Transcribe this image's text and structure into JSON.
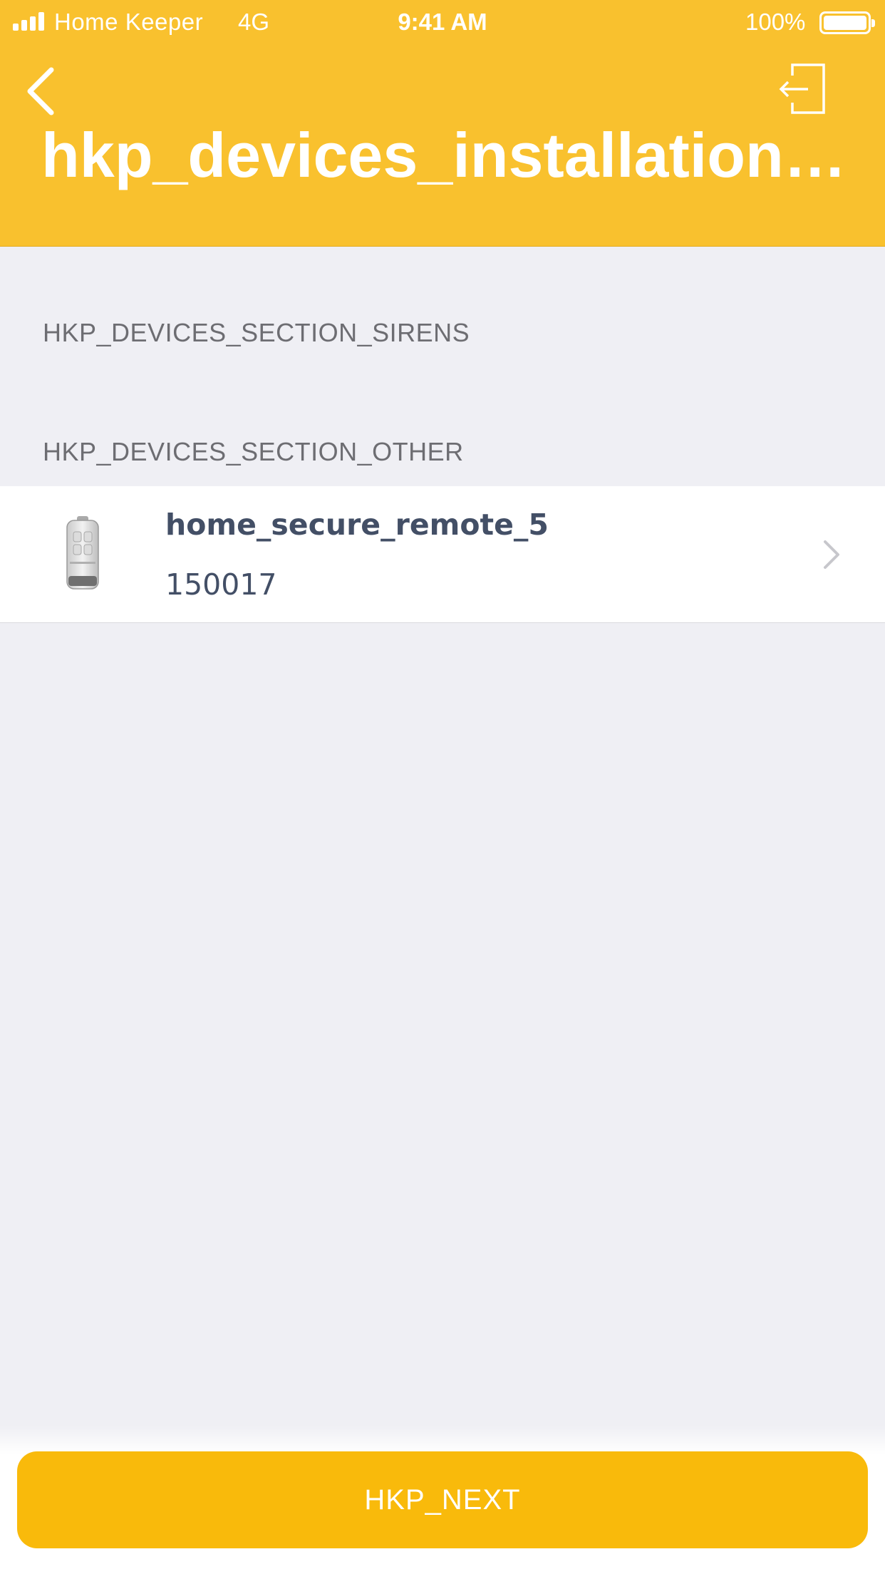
{
  "status_bar": {
    "carrier": "Home Keeper",
    "network": "4G",
    "time": "9:41 AM",
    "battery_percent": "100%"
  },
  "nav": {
    "back_icon": "chevron-left-icon",
    "exit_icon": "logout-icon",
    "title": "hkp_devices_installation_..."
  },
  "sections": [
    {
      "header": "HKP_DEVICES_SECTION_SIRENS",
      "items": []
    },
    {
      "header": "HKP_DEVICES_SECTION_OTHER",
      "items": [
        {
          "name": "home_secure_remote_5",
          "id": "150017",
          "icon": "remote-control-icon"
        }
      ]
    }
  ],
  "footer": {
    "next_label": "HKP_NEXT"
  },
  "colors": {
    "header_bg": "#f9c12e",
    "button_bg": "#f9ba0b",
    "list_bg": "#efeff4",
    "device_text": "#434f66",
    "section_text": "#6d6d72"
  }
}
